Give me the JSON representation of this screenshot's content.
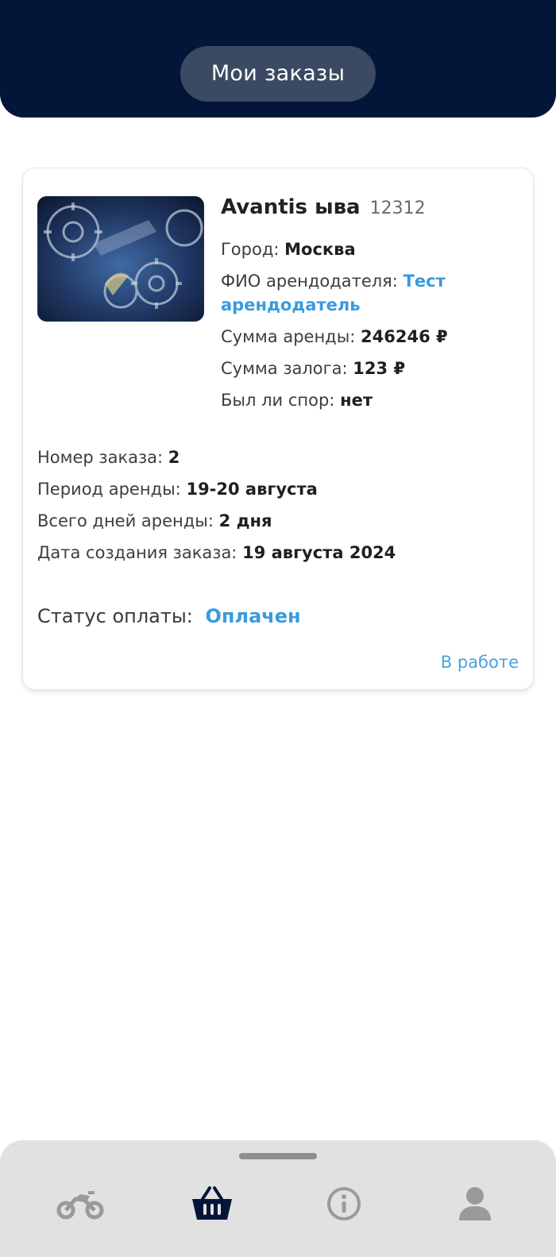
{
  "header": {
    "title": "Мои заказы"
  },
  "order": {
    "name": "Avantis ыва",
    "number_tag": "12312",
    "city_label": "Город:",
    "city_value": "Москва",
    "landlord_label": "ФИО арендодателя:",
    "landlord_value_line1": "Тест",
    "landlord_value_line2": "арендодатель",
    "rent_sum_label": "Сумма аренды:",
    "rent_sum_value": "246246 ₽",
    "deposit_label": "Сумма залога:",
    "deposit_value": "123 ₽",
    "dispute_label": "Был ли спор:",
    "dispute_value": "нет",
    "order_no_label": "Номер заказа:",
    "order_no_value": "2",
    "period_label": "Период аренды:",
    "period_value": "19-20 августа",
    "days_label": "Всего дней аренды:",
    "days_value": "2 дня",
    "created_label": "Дата создания заказа:",
    "created_value": "19 августа 2024",
    "payment_label": "Статус оплаты:",
    "payment_value": "Оплачен",
    "work_status": "В работе"
  },
  "colors": {
    "header_bg": "#03163a",
    "accent": "#3a9bdc",
    "nav_active": "#03163a",
    "nav_inactive": "#9a9a9a"
  },
  "nav": [
    {
      "icon": "motorcycle-icon",
      "active": false
    },
    {
      "icon": "basket-icon",
      "active": true
    },
    {
      "icon": "info-icon",
      "active": false
    },
    {
      "icon": "user-icon",
      "active": false
    }
  ]
}
